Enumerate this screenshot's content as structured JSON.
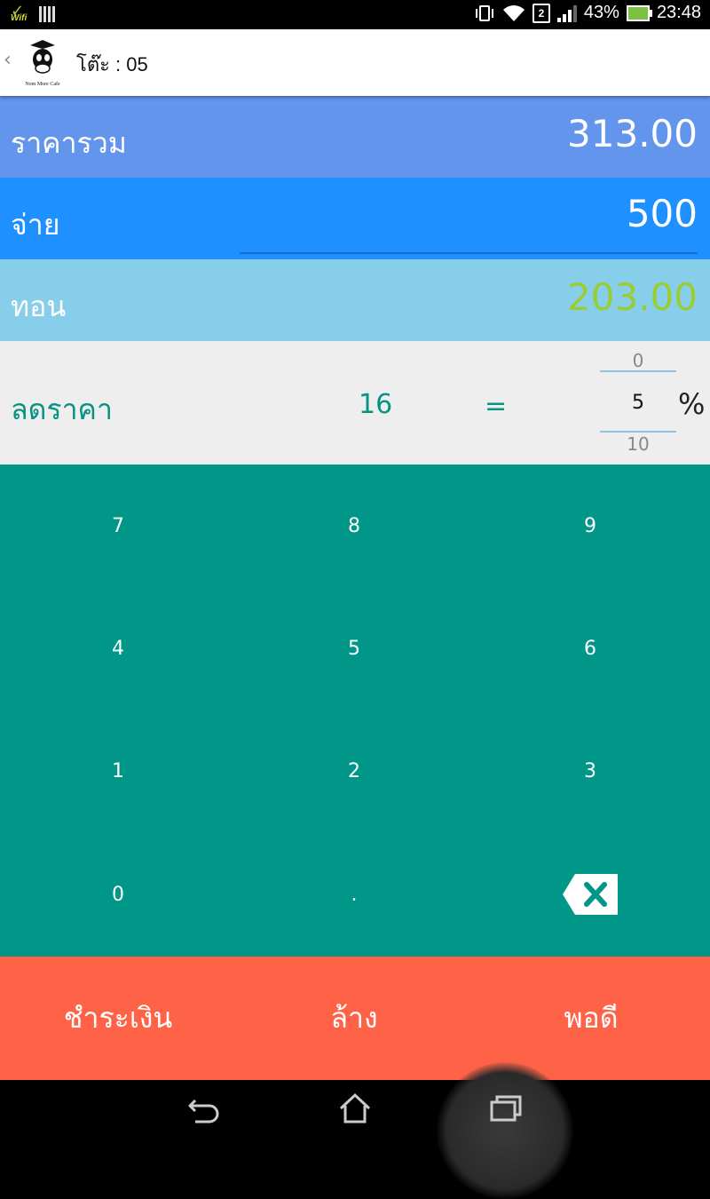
{
  "status_bar": {
    "wifi_badge_text": "Wifi",
    "sim_slot": "2",
    "battery_percent": "43%",
    "time": "23:48",
    "icons": [
      "wifi-check-icon",
      "barcode-icon",
      "vibrate-icon",
      "wifi-signal-icon",
      "sim-icon",
      "cell-signal-icon",
      "battery-charging-icon"
    ]
  },
  "app_bar": {
    "logo_text": "Nom More Cafe",
    "title": "โต๊ะ : 05"
  },
  "summary": {
    "total_label": "ราคารวม",
    "total_value": "313.00",
    "pay_label": "จ่าย",
    "pay_value": "500",
    "change_label": "ทอน",
    "change_value": "203.00"
  },
  "discount": {
    "label": "ลดราคา",
    "amount": "16",
    "equals": "=",
    "picker_prev": "0",
    "picker_current": "5",
    "picker_next": "10",
    "unit": "%"
  },
  "keypad": {
    "keys": [
      "7",
      "8",
      "9",
      "4",
      "5",
      "6",
      "1",
      "2",
      "3",
      "0",
      "."
    ],
    "backspace_icon": "backspace-icon"
  },
  "actions": {
    "pay": "ชำระเงิน",
    "clear": "ล้าง",
    "exact": "พอดี"
  },
  "colors": {
    "total_bg": "#6495ED",
    "pay_bg": "#1E90FF",
    "change_bg": "#87CEEB",
    "change_value": "#9ACD32",
    "discount_text": "#079383",
    "keypad_bg": "#009688",
    "action_bg": "#FF6347"
  },
  "nav_bar": {
    "icons": [
      "back-icon",
      "home-icon",
      "recent-apps-icon"
    ]
  }
}
